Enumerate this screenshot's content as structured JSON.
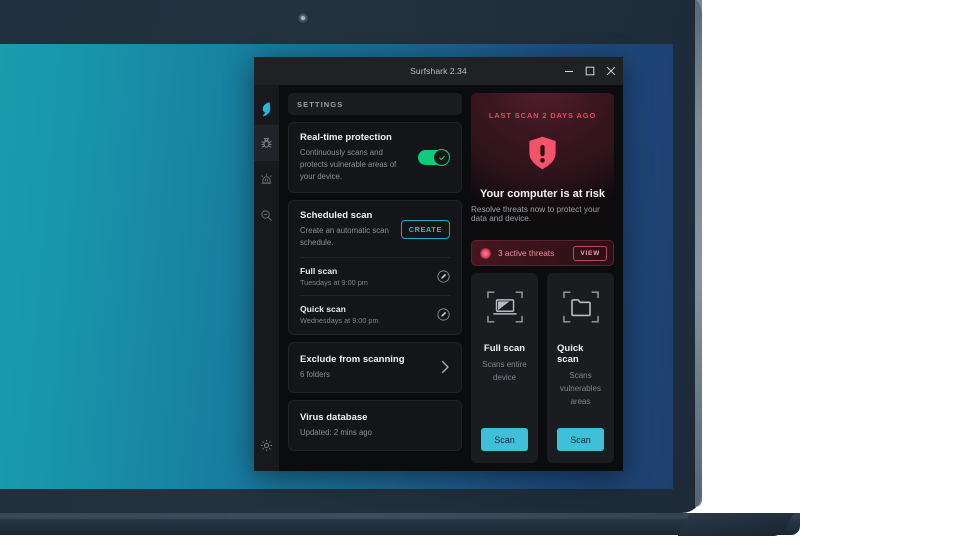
{
  "window": {
    "title": "Surfshark 2.34",
    "controls": [
      {
        "name": "minimize",
        "icon": "minimize-icon"
      },
      {
        "name": "maximize",
        "icon": "maximize-icon"
      },
      {
        "name": "close",
        "icon": "close-icon"
      }
    ]
  },
  "rail": {
    "items": [
      {
        "icon": "surfshark-logo-icon",
        "name": "brand-logo",
        "active": false
      },
      {
        "icon": "bug-antivirus-icon",
        "name": "antivirus",
        "active": true
      },
      {
        "icon": "alert-siren-icon",
        "name": "alerts",
        "active": false
      },
      {
        "icon": "search-privacy-icon",
        "name": "search",
        "active": false
      }
    ],
    "bottom": {
      "icon": "gear-icon",
      "name": "settings"
    }
  },
  "settings": {
    "header": "SETTINGS",
    "realtime": {
      "title": "Real-time protection",
      "description": "Continuously scans and protects vulnerable areas of your device.",
      "toggle_on": true,
      "toggle_color": "#0fcc7c"
    },
    "scheduled": {
      "title": "Scheduled scan",
      "description": "Create an automatic scan schedule.",
      "create_label": "CREATE",
      "items": [
        {
          "name": "Full scan",
          "time": "Tuesdays at 9:00 pm"
        },
        {
          "name": "Quick scan",
          "time": "Wednesdays at 9:00 pm"
        }
      ]
    },
    "exclude": {
      "title": "Exclude from scanning",
      "subtitle": "6 folders"
    },
    "database": {
      "title": "Virus database",
      "subtitle": "Updated: 2 mins ago"
    }
  },
  "status": {
    "last_scan": "LAST SCAN 2 DAYS AGO",
    "title": "Your computer is at risk",
    "subtitle": "Resolve threats now to protect your data and device.",
    "accent_color": "#e04b66",
    "shield_color": "#f4536a"
  },
  "threats": {
    "text": "3 active threats",
    "count": 3,
    "view_label": "VIEW"
  },
  "scan_cards": [
    {
      "icon": "laptop-scan-icon",
      "title": "Full scan",
      "description": "Scans entire device",
      "button": "Scan"
    },
    {
      "icon": "folder-scan-icon",
      "title": "Quick scan",
      "description": "Scans vulnerables areas",
      "button": "Scan"
    }
  ],
  "theme": {
    "wallpaper_left": "#1ba0ad",
    "wallpaper_right": "#1e3f6e",
    "scan_button": "#3fc0d8",
    "link_accent": "#35b7d4"
  }
}
